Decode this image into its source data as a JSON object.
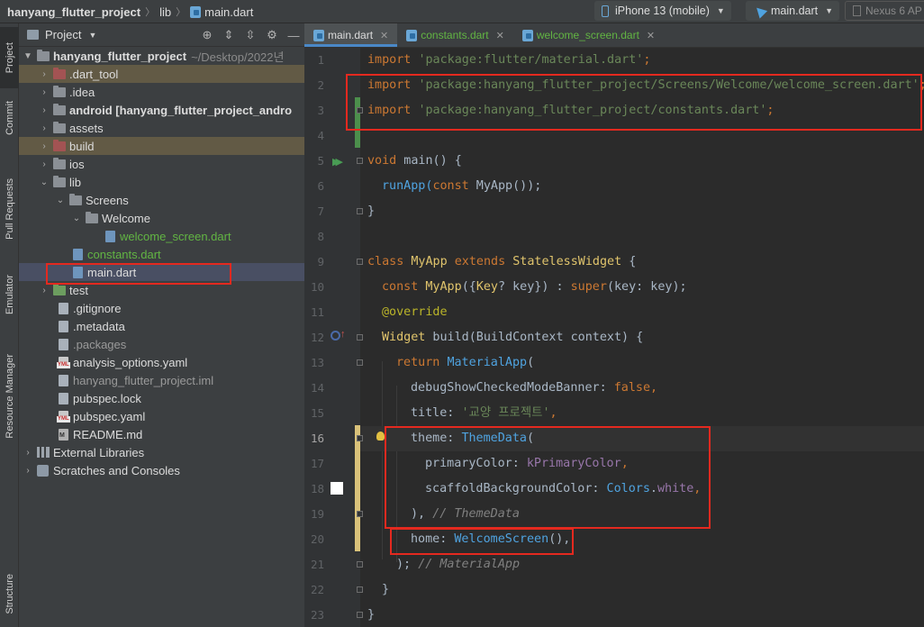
{
  "breadcrumb": {
    "project": "hanyang_flutter_project",
    "folder": "lib",
    "file": "main.dart"
  },
  "toolbar": {
    "device": "iPhone 13 (mobile)",
    "run_config": "main.dart",
    "emulator": "Nexus 6 AP"
  },
  "sidebar_tabs": {
    "project": "Project",
    "commit": "Commit",
    "pull_requests": "Pull Requests",
    "emulator": "Emulator",
    "resource_manager": "Resource Manager",
    "structure": "Structure"
  },
  "project_panel": {
    "title": "Project",
    "tree": {
      "root": {
        "label": "hanyang_flutter_project",
        "path": "~/Desktop/2022년"
      },
      "dart_tool": ".dart_tool",
      "idea": ".idea",
      "android": "android [hanyang_flutter_project_andro",
      "assets": "assets",
      "build": "build",
      "ios": "ios",
      "lib": "lib",
      "screens": "Screens",
      "welcome": "Welcome",
      "welcome_screen": "welcome_screen.dart",
      "constants": "constants.dart",
      "main": "main.dart",
      "test": "test",
      "gitignore": ".gitignore",
      "metadata": ".metadata",
      "packages": ".packages",
      "analysis_options": "analysis_options.yaml",
      "iml": "hanyang_flutter_project.iml",
      "pubspec_lock": "pubspec.lock",
      "pubspec_yaml": "pubspec.yaml",
      "readme": "README.md",
      "external_libraries": "External Libraries",
      "scratches": "Scratches and Consoles"
    }
  },
  "editor": {
    "tabs": [
      "main.dart",
      "constants.dart",
      "welcome_screen.dart"
    ],
    "line_numbers": [
      "1",
      "2",
      "3",
      "4",
      "5",
      "6",
      "7",
      "8",
      "9",
      "10",
      "11",
      "12",
      "13",
      "14",
      "15",
      "16",
      "17",
      "18",
      "19",
      "20",
      "21",
      "22",
      "23"
    ],
    "code": {
      "l1_kw": "import",
      "l1_str": "'package:flutter/material.dart'",
      "semi": ";",
      "l2_str": "'package:hanyang_flutter_project/Screens/Welcome/welcome_screen.dart'",
      "l3_str": "'package:hanyang_flutter_project/constants.dart'",
      "void": "void",
      "main_sig": " main() {",
      "runapp": "runApp(",
      "const": "const",
      "myapp_call": " MyApp());",
      "close_brace": "}",
      "class": "class",
      "myapp": "MyApp",
      "extends": "extends",
      "stateless": "StatelessWidget",
      "open_brace": " {",
      "ctor_rest": "({",
      "key_type": "Key",
      "key_rest": "? key}) : ",
      "super": "super",
      "super_rest": "(key: key);",
      "override": "@override",
      "widget": "Widget",
      "build_rest": " build(BuildContext context) {",
      "return": "return",
      "materialapp": "MaterialApp",
      "paren": "(",
      "debug_prop": "debugShowCheckedModeBanner: ",
      "false": "false",
      "comma": ",",
      "title_prop": "title: ",
      "title_str": "'교양 프로젝트'",
      "theme_prop": "theme: ",
      "themedata": "ThemeData",
      "primary_prop": "primaryColor: ",
      "kprimary": "kPrimaryColor",
      "scaffold_prop": "scaffoldBackgroundColor: ",
      "colors": "Colors",
      "dot": ".",
      "white": "white",
      "theme_close": "), ",
      "theme_cmt": "// ThemeData",
      "home_prop": "home: ",
      "welcome_screen": "WelcomeScreen",
      "home_rest": "(),",
      "mat_close": "); ",
      "mat_cmt": "// MaterialApp",
      "inner_close": "}",
      "outer_close": "}"
    }
  },
  "colors": {
    "highlight_box": "#e4291f",
    "editor_bg": "#2b2b2b",
    "panel_bg": "#3c3f41"
  }
}
